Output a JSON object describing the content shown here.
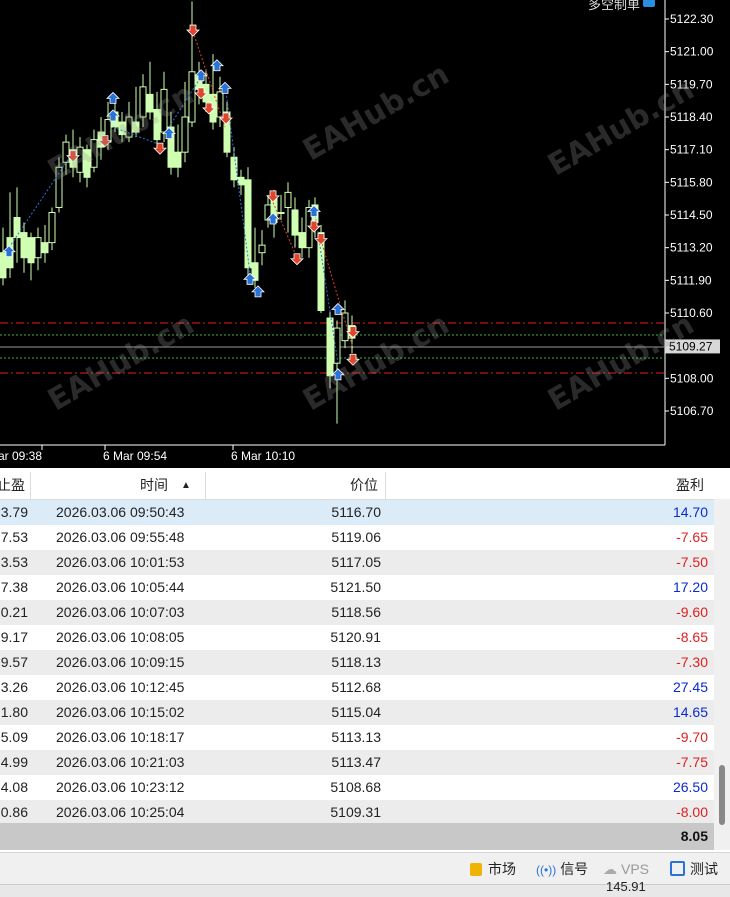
{
  "chart": {
    "symbol_label": "多空制单",
    "current_price": "5109.27",
    "price_axis": [
      "5122.30",
      "5121.00",
      "5119.70",
      "5118.40",
      "5117.10",
      "5115.80",
      "5114.50",
      "5113.20",
      "5111.90",
      "5110.60",
      "5108.00",
      "5106.70"
    ],
    "time_axis": [
      "ar 09:38",
      "6 Mar 09:54",
      "6 Mar 10:10"
    ],
    "colors": {
      "background": "#000000",
      "candle": "#cfffb0",
      "buy_arrow": "#2a73d6",
      "sell_arrow": "#e0442a",
      "sl_tp_line": "#e02020",
      "price_line": "#9a9a9a",
      "bid_line": "#3cb04a"
    }
  },
  "watermark": "EAHub.cn",
  "table": {
    "headers": {
      "sl": "止盈",
      "time": "时间",
      "price": "价位",
      "profit": "盈利"
    },
    "rows": [
      {
        "sl": "3.79",
        "time": "2026.03.06 09:50:43",
        "price": "5116.70",
        "profit": "14.70",
        "sign": "pos"
      },
      {
        "sl": "7.53",
        "time": "2026.03.06 09:55:48",
        "price": "5119.06",
        "profit": "-7.65",
        "sign": "neg"
      },
      {
        "sl": "3.53",
        "time": "2026.03.06 10:01:53",
        "price": "5117.05",
        "profit": "-7.50",
        "sign": "neg"
      },
      {
        "sl": "7.38",
        "time": "2026.03.06 10:05:44",
        "price": "5121.50",
        "profit": "17.20",
        "sign": "pos"
      },
      {
        "sl": "0.21",
        "time": "2026.03.06 10:07:03",
        "price": "5118.56",
        "profit": "-9.60",
        "sign": "neg"
      },
      {
        "sl": "9.17",
        "time": "2026.03.06 10:08:05",
        "price": "5120.91",
        "profit": "-8.65",
        "sign": "neg"
      },
      {
        "sl": "9.57",
        "time": "2026.03.06 10:09:15",
        "price": "5118.13",
        "profit": "-7.30",
        "sign": "neg"
      },
      {
        "sl": "3.26",
        "time": "2026.03.06 10:12:45",
        "price": "5112.68",
        "profit": "27.45",
        "sign": "pos"
      },
      {
        "sl": "1.80",
        "time": "2026.03.06 10:15:02",
        "price": "5115.04",
        "profit": "14.65",
        "sign": "pos"
      },
      {
        "sl": "5.09",
        "time": "2026.03.06 10:18:17",
        "price": "5113.13",
        "profit": "-9.70",
        "sign": "neg"
      },
      {
        "sl": "4.99",
        "time": "2026.03.06 10:21:03",
        "price": "5113.47",
        "profit": "-7.75",
        "sign": "neg"
      },
      {
        "sl": "4.08",
        "time": "2026.03.06 10:23:12",
        "price": "5108.68",
        "profit": "26.50",
        "sign": "pos"
      },
      {
        "sl": "0.86",
        "time": "2026.03.06 10:25:04",
        "price": "5109.31",
        "profit": "-8.00",
        "sign": "neg"
      }
    ],
    "total": "8.05",
    "selected_row_color": "#dcebf8",
    "alt_row_color": "#ececec"
  },
  "statusbar": {
    "market": "市场",
    "signals": "信号",
    "vps": "VPS",
    "tester": "测试",
    "bottom_value": "145.91"
  }
}
